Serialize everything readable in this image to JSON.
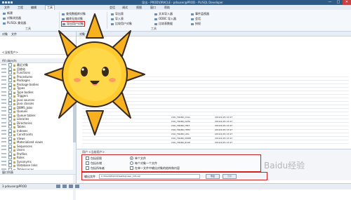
{
  "window": {
    "title": "导出 - PROD\\ORACLE - pdsuser@PROD - PL/SQL Developer",
    "minimize": "—",
    "maximize": "□",
    "close": "✕"
  },
  "menu": {
    "items": [
      "文件",
      "工程",
      "编辑",
      "工具",
      "会话",
      "调试",
      "视图",
      "窗口",
      "帮助"
    ],
    "active_index": 3
  },
  "ribbon": {
    "left": [
      "新建",
      "打开",
      "保存",
      "另存为",
      "打印"
    ],
    "left_sub": [
      "对象浏览器",
      "查找",
      "PL/SQL 美化器"
    ],
    "tools": [
      {
        "label": "查找数据库对象",
        "icon": "find-db-icon"
      },
      {
        "label": "编译无效对象",
        "icon": "compile-icon"
      },
      {
        "label": "导出用户对象",
        "icon": "export-icon"
      }
    ],
    "tools2": [
      "导出表",
      "导入表",
      "比较用户对象"
    ],
    "tools3": [
      "文本导入器",
      "ODBC 导入器",
      "比较表数据"
    ],
    "tools4": [
      "事件监视器",
      "会话",
      "授权"
    ],
    "group_label": "工具",
    "group_label_left": "工具"
  },
  "left_panel": {
    "toolbar_items": [
      "对象",
      "文件"
    ],
    "filter": "<当前用户>",
    "objects_label": "All objects",
    "tree": [
      "最近对象",
      "回收站",
      "Functions",
      "Procedures",
      "Packages",
      "Package bodies",
      "Types",
      "Type bodies",
      "Triggers",
      "Java sources",
      "Java classes",
      "DBMS_Jobs",
      "Queues",
      "Queue tables",
      "Libraries",
      "Directories",
      "Tables",
      "Indexes",
      "Constraints",
      "Views",
      "Materialized views",
      "Sequences",
      "Users",
      "Profiles",
      "Roles",
      "Synonyms",
      "Database links",
      "Tablespaces"
    ],
    "bottom_label": "窗口列表"
  },
  "main": {
    "tabs": [
      "对象",
      "文件"
    ],
    "objects": [
      [
        "CSO_TRANS_COLL",
        "2019/1/29 13:47"
      ],
      [
        "CSO_TRANS_DATA",
        "2019/1/29 13:47"
      ],
      [
        "CSO_TRANS_HIST",
        "2019/1/29 13:47"
      ],
      [
        "CSO_TRANS_ITEM",
        "2019/1/29 13:47"
      ],
      [
        "CSO_TRANS_LOG",
        "2019/1/29 13:47"
      ],
      [
        "CSO_TRANS_NODE",
        "2019/1/29 13:47"
      ],
      [
        "CSO_TRANS_RULE",
        "2019/1/29 13:47"
      ]
    ]
  },
  "export_panel": {
    "heading": "用户  <当前用户>",
    "options": {
      "include_storage": "包括权限",
      "include_grants": "包括存储",
      "include_owner": "包括所有者",
      "single_file": "单个文件",
      "one_file_per_object": "每个对象一个文件",
      "per_object_folder": "在单一文件中输出对象的结构和内容"
    },
    "file_label": "输出文件",
    "file_path": "C:\\Users\\Public\\Desktop\\user_info.sql",
    "export_button": "导出",
    "view_button": "查看"
  },
  "status": {
    "text": "3    pdsuser@PROD"
  },
  "watermark": "Baidu经验"
}
